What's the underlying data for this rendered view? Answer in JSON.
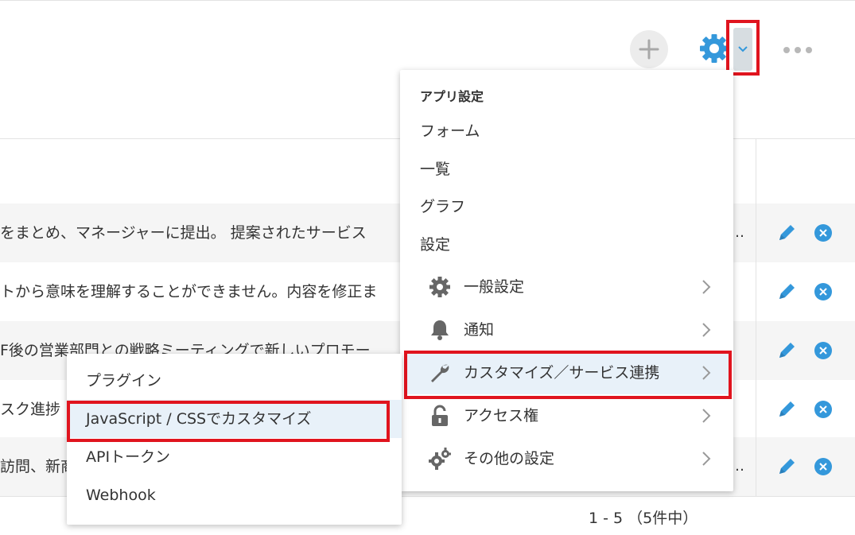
{
  "toolbar": {
    "add_icon": "plus-icon",
    "settings_icon": "gear-icon",
    "dropdown_icon": "chevron-down-icon",
    "more_icon": "ellipsis-icon",
    "accent_color": "#3498db",
    "highlight_color": "#e0141e"
  },
  "table": {
    "rows": [
      {
        "text": "をまとめ、マネージャーに提出。 提案されたサービス",
        "trailing": "…"
      },
      {
        "text": "トから意味を理解することができません。内容を修正ま",
        "trailing": "."
      },
      {
        "text": "F後の営業部門との戦略ミーティングで新しいプロモー",
        "trailing": "."
      },
      {
        "text": "スク進捗",
        "trailing": ""
      },
      {
        "text": "訪問、新商",
        "trailing": "…"
      }
    ]
  },
  "pager": {
    "label": "1 - 5 （5件中）"
  },
  "settings_menu": {
    "section_title": "アプリ設定",
    "items": [
      "フォーム",
      "一覧",
      "グラフ",
      "設定"
    ],
    "sub_items": [
      {
        "label": "一般設定",
        "icon": "gear-icon"
      },
      {
        "label": "通知",
        "icon": "bell-icon"
      },
      {
        "label": "カスタマイズ／サービス連携",
        "icon": "wrench-icon"
      },
      {
        "label": "アクセス権",
        "icon": "lock-icon"
      },
      {
        "label": "その他の設定",
        "icon": "gears-icon"
      }
    ]
  },
  "customize_submenu": {
    "items": [
      "プラグイン",
      "JavaScript / CSSでカスタマイズ",
      "APIトークン",
      "Webhook"
    ]
  }
}
